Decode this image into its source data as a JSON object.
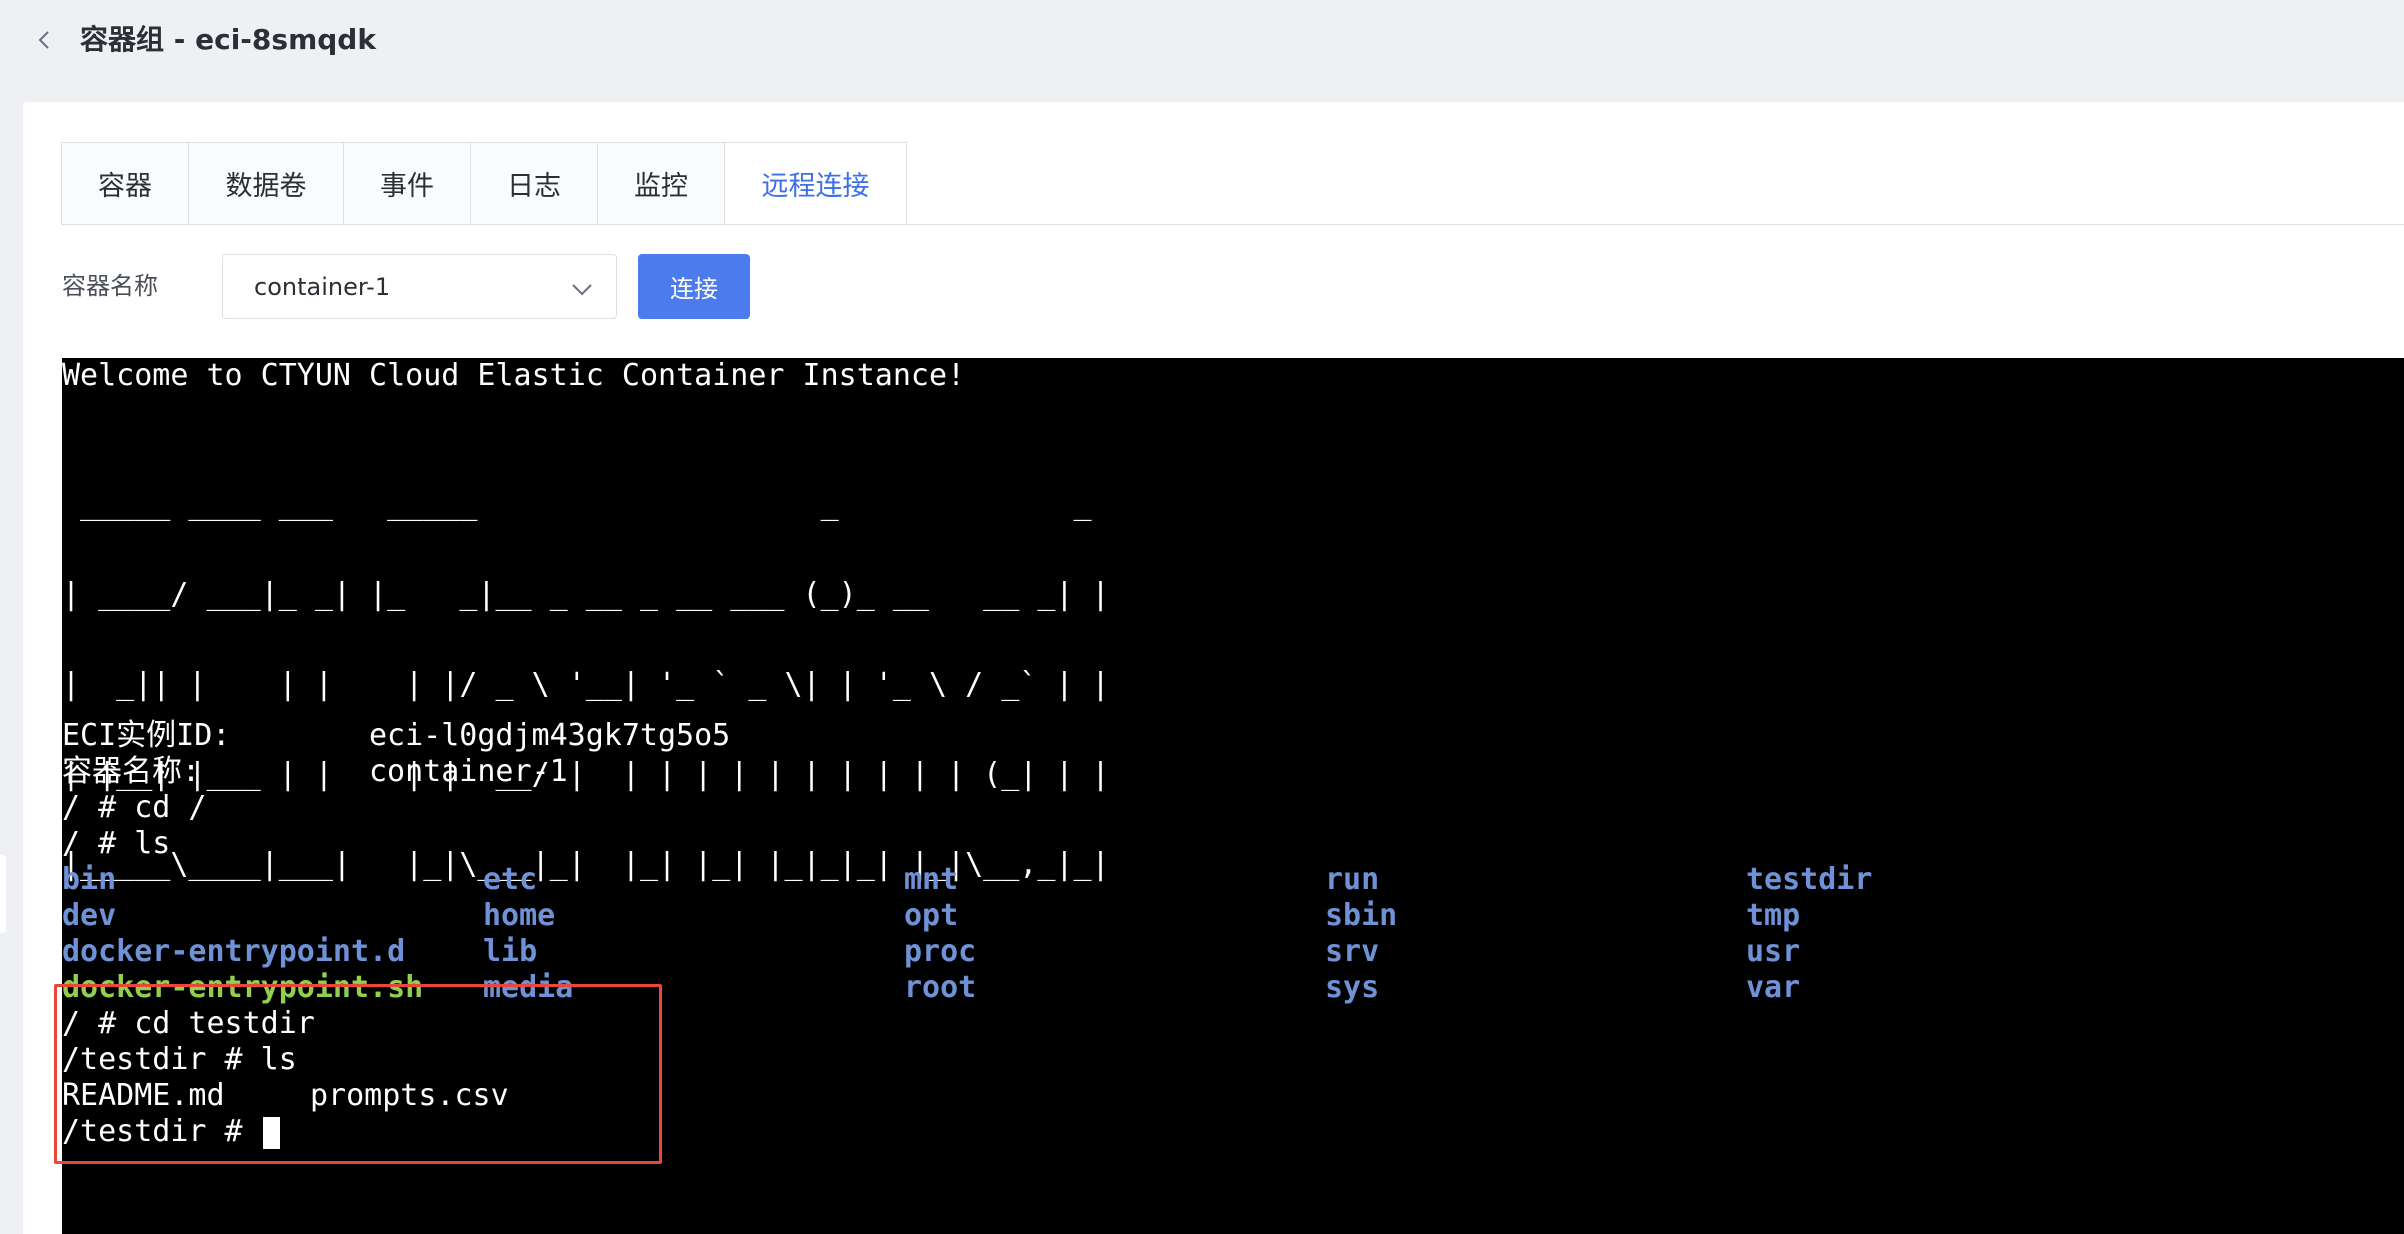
{
  "header": {
    "title": "容器组 - eci-8smqdk",
    "back_icon": "chevron-left-icon"
  },
  "tabs": [
    {
      "label": "容器",
      "active": false
    },
    {
      "label": "数据卷",
      "active": false
    },
    {
      "label": "事件",
      "active": false
    },
    {
      "label": "日志",
      "active": false
    },
    {
      "label": "监控",
      "active": false
    },
    {
      "label": "远程连接",
      "active": true
    }
  ],
  "form": {
    "container_label": "容器名称",
    "container_value": "container-1",
    "connect_label": "连接"
  },
  "terminal": {
    "welcome": "Welcome to CTYUN Cloud Elastic Container Instance!",
    "ascii_art": [
      " _____ ____ ___   _____                   _             _ ",
      "| ____/ ___|_ _| |_   _|__ _ __ _ __ ___ (_)_ __   __ _| |",
      "|  _|| |    | |    | |/ _ \\ '__| '_ ` _ \\| | '_ \\ / _` | |",
      "| |__| |___ | |    | |  __/ |  | | | | | | | | | | (_| | |",
      "|_____\\____|___|   |_|\\___|_|  |_| |_| |_|_|_| |_|\\__,_|_|"
    ],
    "instance_id_key": "ECI实例ID:",
    "instance_id_val": "eci-l0gdjm43gk7tg5o5",
    "container_name_key": "容器名称:",
    "container_name_val": "container-1",
    "cmd_cd_root": "/ # cd /",
    "cmd_ls": "/ # ls",
    "ls_columns": [
      [
        "bin",
        "dev",
        "docker-entrypoint.d",
        "docker-entrypoint.sh"
      ],
      [
        "etc",
        "home",
        "lib",
        "media"
      ],
      [
        "mnt",
        "opt",
        "proc",
        "root"
      ],
      [
        "run",
        "sbin",
        "srv",
        "sys"
      ],
      [
        "testdir",
        "tmp",
        "usr",
        "var"
      ]
    ],
    "cmd_cd_testdir": "/ # cd testdir",
    "cmd_ls_testdir": "/testdir # ls",
    "testdir_files": [
      "README.md",
      "prompts.csv"
    ],
    "prompt_current": "/testdir # "
  },
  "colors": {
    "accent": "#3d6fe8",
    "button": "#4b7bec",
    "dir": "#6f92d6",
    "exec": "#8fd14f",
    "highlight": "#e8473a"
  }
}
